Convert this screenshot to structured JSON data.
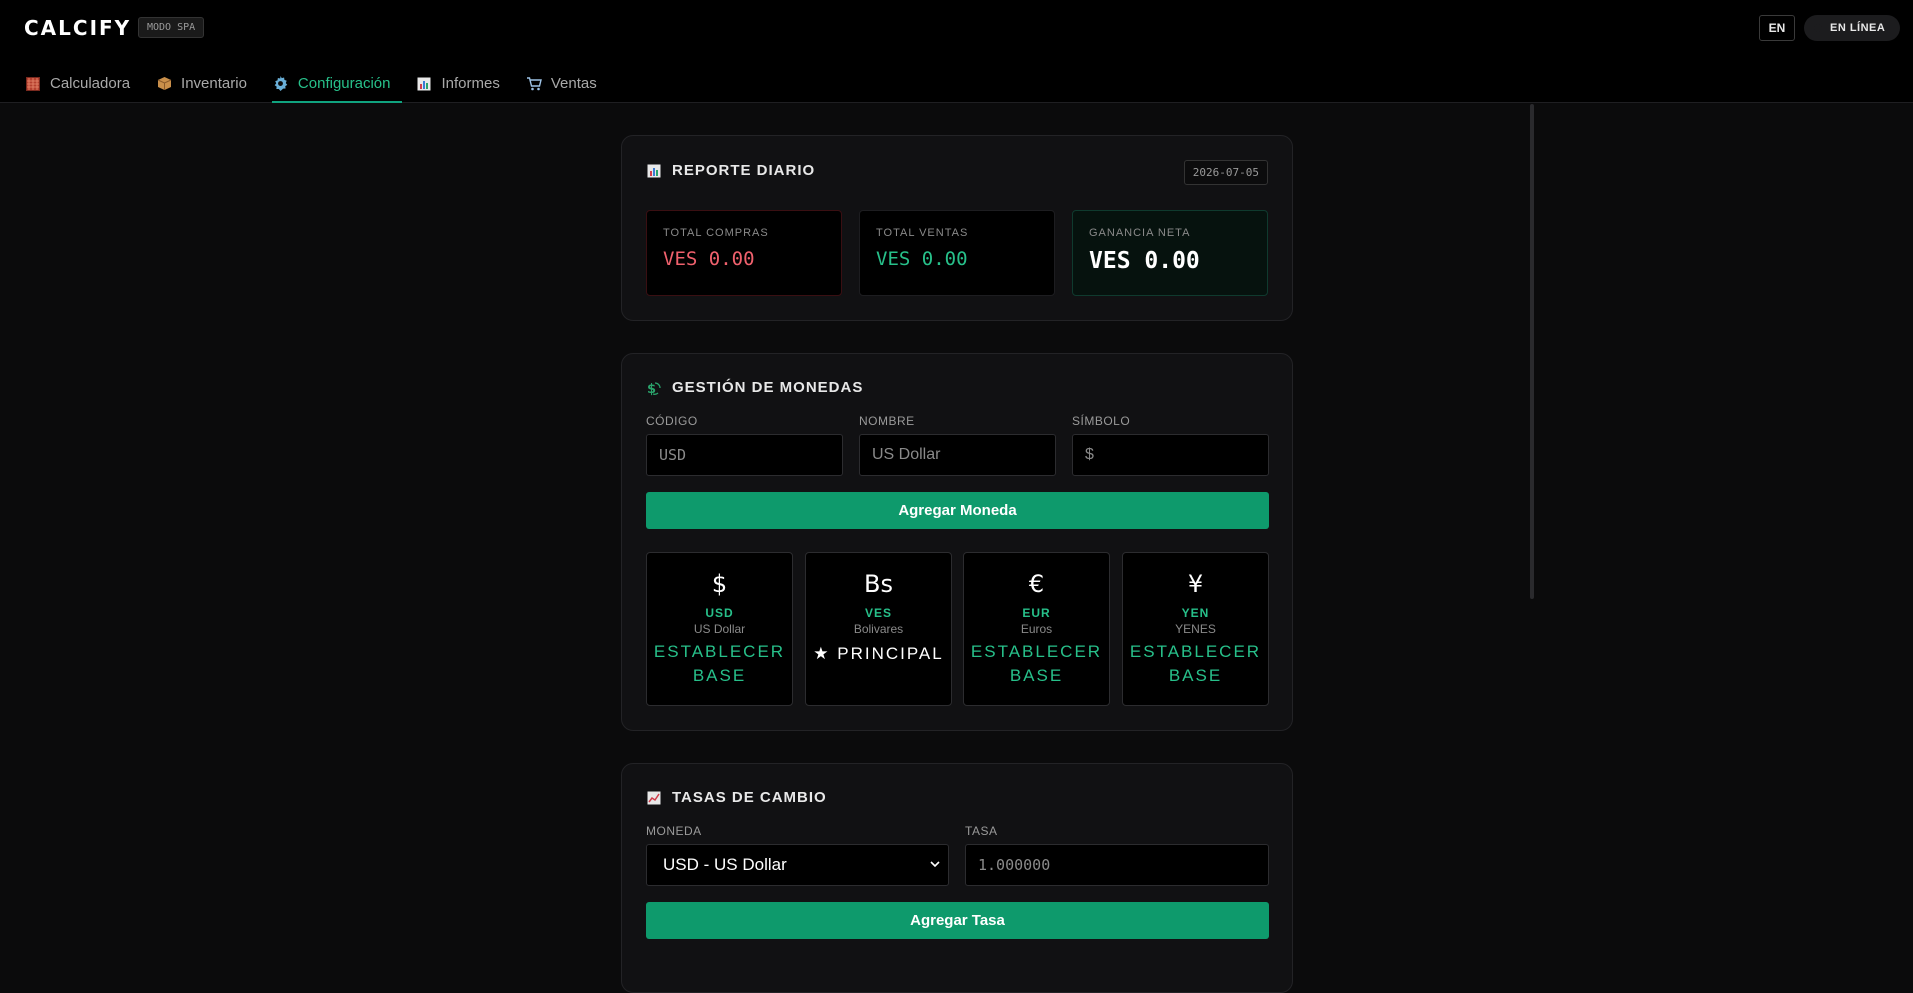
{
  "header": {
    "brand": "CALCIFY",
    "mode_badge": "MODO SPA",
    "language": "EN",
    "status": "EN LÍNEA"
  },
  "nav": {
    "tabs": [
      {
        "label": "Calculadora",
        "icon": "abacus-icon",
        "active": false
      },
      {
        "label": "Inventario",
        "icon": "package-icon",
        "active": false
      },
      {
        "label": "Configuración",
        "icon": "gear-icon",
        "active": true
      },
      {
        "label": "Informes",
        "icon": "bar-chart-icon",
        "active": false
      },
      {
        "label": "Ventas",
        "icon": "cart-icon",
        "active": false
      }
    ]
  },
  "daily_report": {
    "title": "REPORTE DIARIO",
    "date": "2026-07-05",
    "stats": [
      {
        "label": "TOTAL COMPRAS",
        "value": "VES 0.00"
      },
      {
        "label": "TOTAL VENTAS",
        "value": "VES 0.00"
      },
      {
        "label": "GANANCIA NETA",
        "value": "VES 0.00"
      }
    ]
  },
  "currency_management": {
    "title": "GESTIÓN DE MONEDAS",
    "fields": {
      "code_label": "CÓDIGO",
      "code_placeholder": "USD",
      "name_label": "NOMBRE",
      "name_placeholder": "US Dollar",
      "symbol_label": "SÍMBOLO",
      "symbol_placeholder": "$"
    },
    "add_button": "Agregar Moneda",
    "currencies": [
      {
        "symbol": "$",
        "code": "USD",
        "name": "US Dollar",
        "action": "ESTABLECER BASE"
      },
      {
        "symbol": "Bs",
        "code": "VES",
        "name": "Bolivares",
        "action": "★ PRINCIPAL"
      },
      {
        "symbol": "€",
        "code": "EUR",
        "name": "Euros",
        "action": "ESTABLECER BASE"
      },
      {
        "symbol": "¥",
        "code": "YEN",
        "name": "YENES",
        "action": "ESTABLECER BASE"
      }
    ]
  },
  "exchange_rates": {
    "title": "TASAS DE CAMBIO",
    "currency_label": "MONEDA",
    "currency_selected": "USD - US Dollar",
    "rate_label": "TASA",
    "rate_placeholder": "1.000000",
    "add_button": "Agregar Tasa"
  },
  "colors": {
    "accent": "#10a37f",
    "accent_text": "#27c08a",
    "danger": "#f0616d",
    "background": "#0b0b0c",
    "card": "#111113"
  }
}
